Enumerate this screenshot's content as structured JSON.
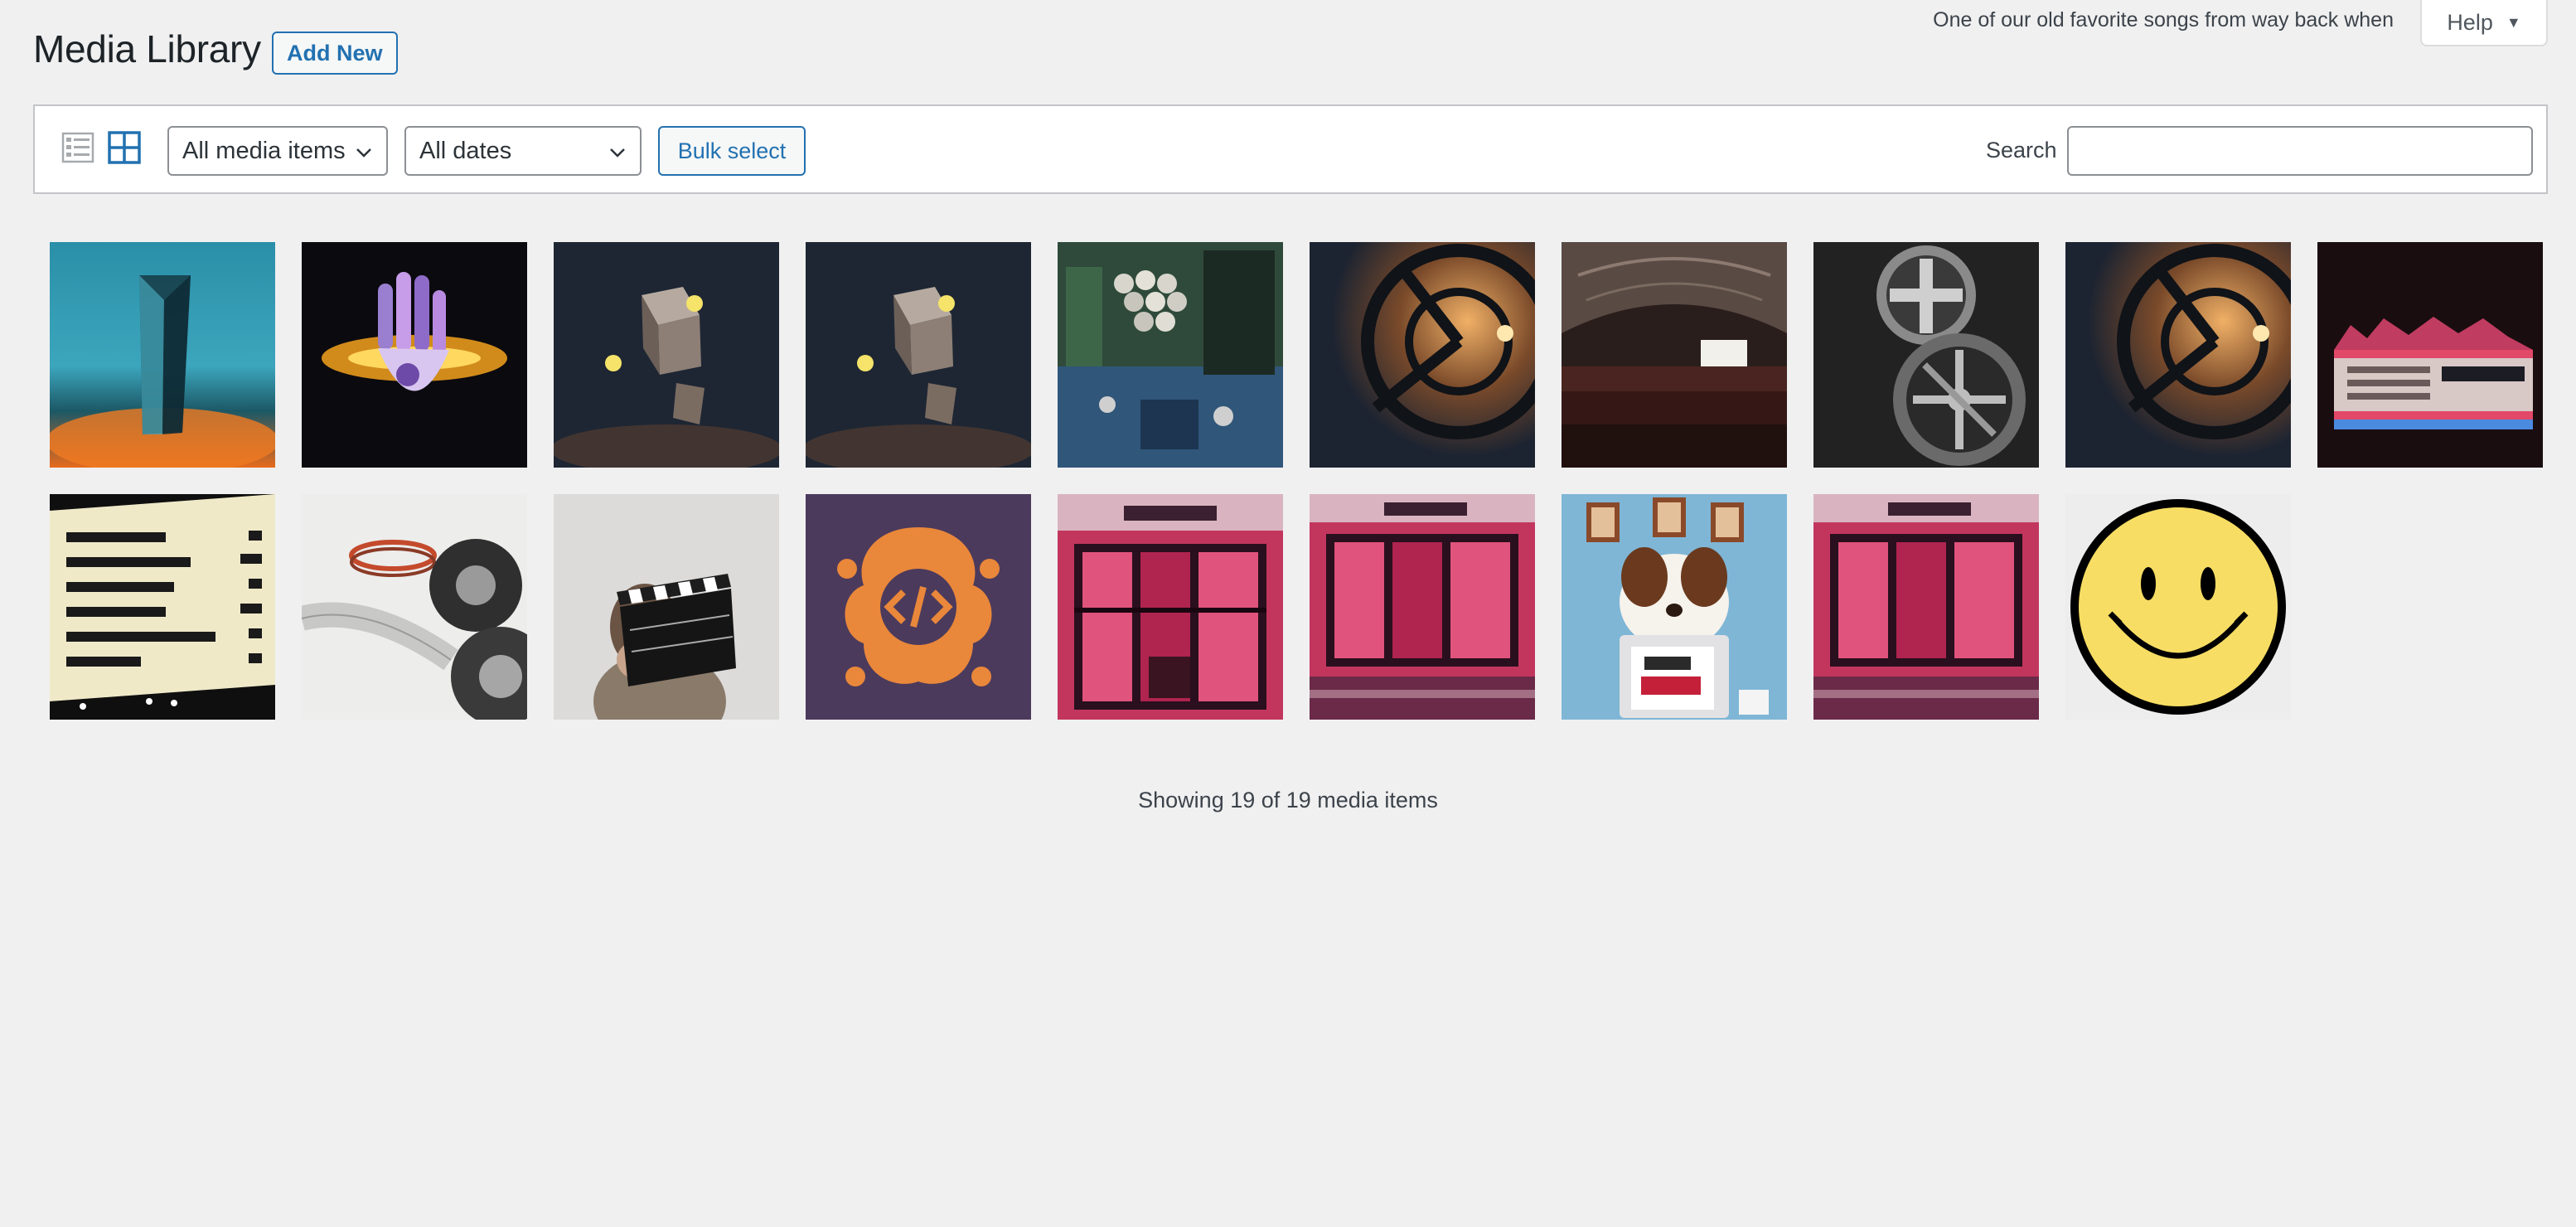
{
  "header": {
    "title": "Media Library",
    "add_new_label": "Add New",
    "hello_dolly": "One of our old favorite songs from way back when",
    "help_label": "Help"
  },
  "toolbar": {
    "view_modes": [
      "list-view-icon",
      "grid-view-icon"
    ],
    "active_view": "grid",
    "type_filter": {
      "selected": "All media items"
    },
    "date_filter": {
      "selected": "All dates"
    },
    "bulk_select_label": "Bulk select",
    "search_label": "Search",
    "search_value": ""
  },
  "media_items": [
    {
      "thumb": "glass-prism"
    },
    {
      "thumb": "glowing-hand"
    },
    {
      "thumb": "floating-cube"
    },
    {
      "thumb": "floating-cube"
    },
    {
      "thumb": "projector-equipment"
    },
    {
      "thumb": "film-reel-warm"
    },
    {
      "thumb": "cinema-theater"
    },
    {
      "thumb": "film-reels-bw"
    },
    {
      "thumb": "film-reel-warm"
    },
    {
      "thumb": "grand-lake-marquee"
    },
    {
      "thumb": "marquee-sign"
    },
    {
      "thumb": "film-strip-reels"
    },
    {
      "thumb": "clapperboard"
    },
    {
      "thumb": "brain-code-logo"
    },
    {
      "thumb": "cinema-storefront"
    },
    {
      "thumb": "cinema-storefront"
    },
    {
      "thumb": "dog-with-a-blog"
    },
    {
      "thumb": "cinema-storefront"
    },
    {
      "thumb": "smiley-face"
    }
  ],
  "footer": {
    "showing_text": "Showing 19 of 19 media items"
  },
  "colors": {
    "accent": "#2271b1",
    "page_bg": "#f0f0f1",
    "border": "#c3c4c7"
  }
}
